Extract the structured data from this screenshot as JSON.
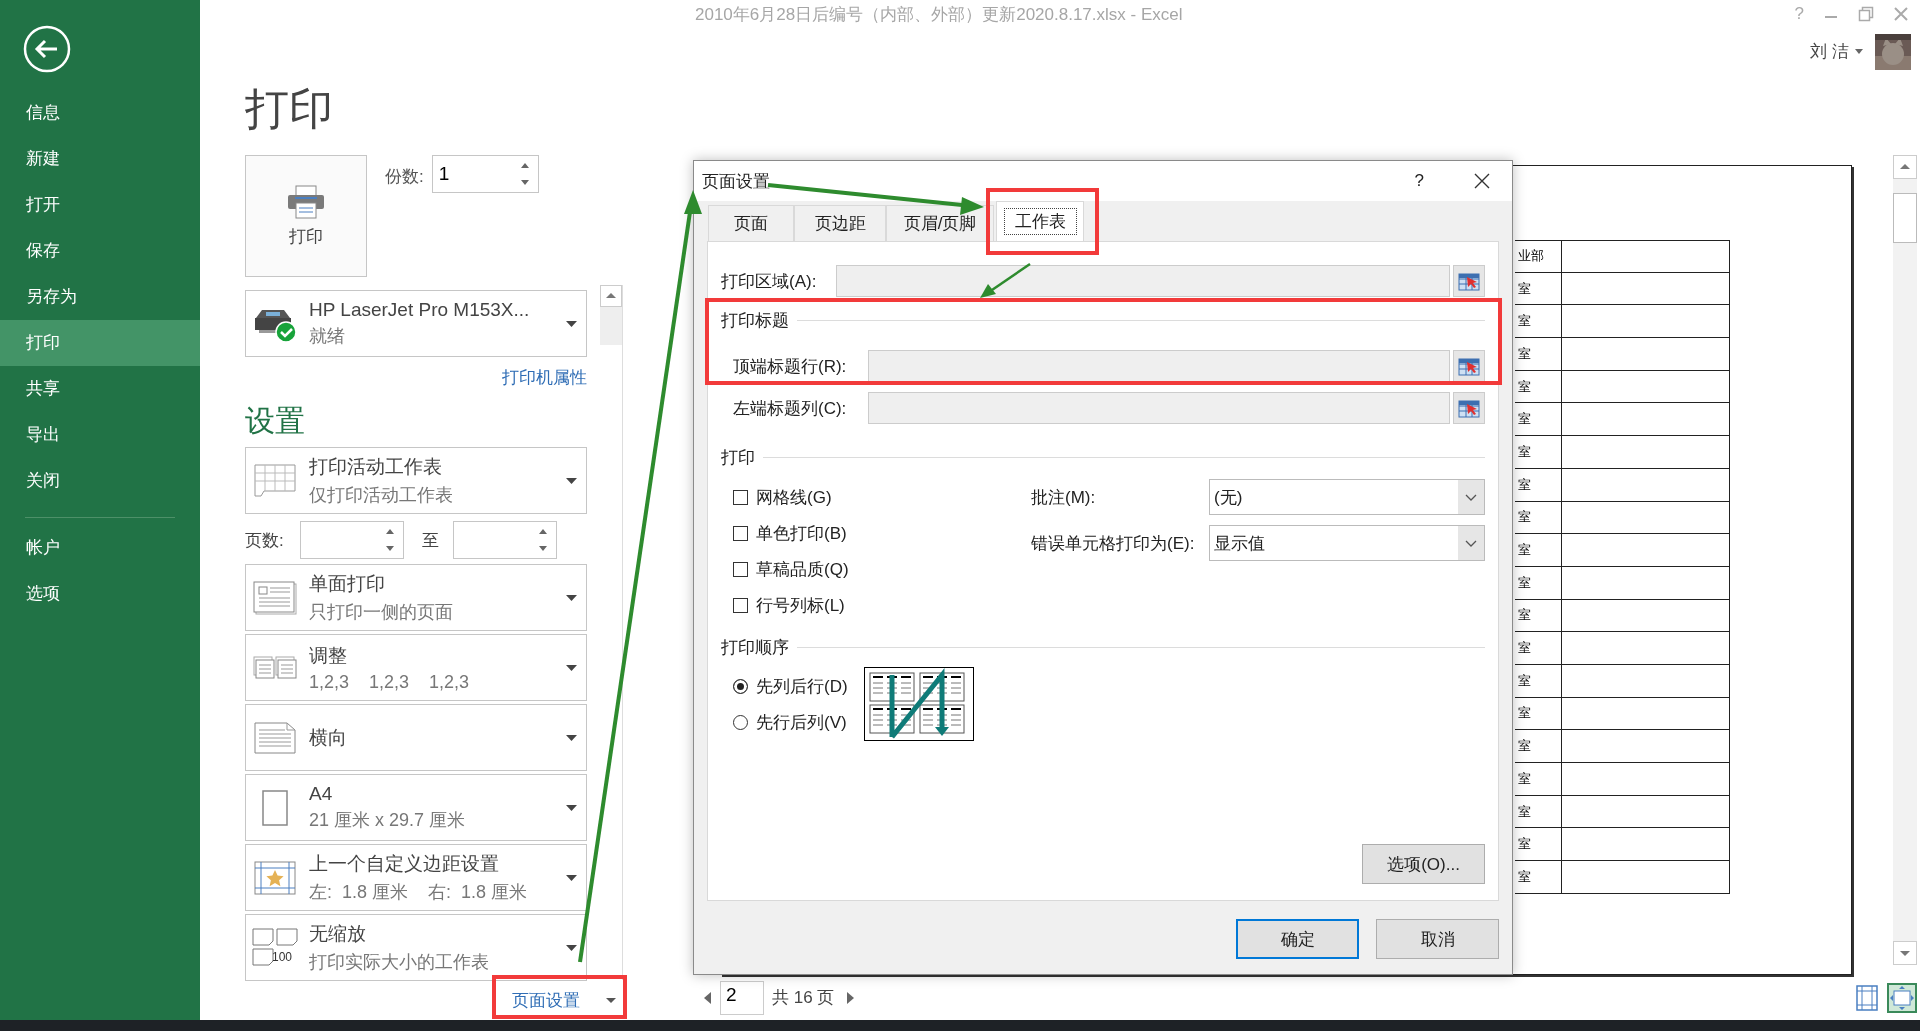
{
  "window": {
    "title": "2010年6月28日后编号（内部、外部）更新2020.8.17.xlsx - Excel",
    "help": "?",
    "user": "刘 洁"
  },
  "sidebar": {
    "items": [
      {
        "label": "信息",
        "selected": false
      },
      {
        "label": "新建",
        "selected": false
      },
      {
        "label": "打开",
        "selected": false
      },
      {
        "label": "保存",
        "selected": false
      },
      {
        "label": "另存为",
        "selected": false
      },
      {
        "label": "打印",
        "selected": true
      },
      {
        "label": "共享",
        "selected": false
      },
      {
        "label": "导出",
        "selected": false
      },
      {
        "label": "关闭",
        "selected": false
      }
    ],
    "bottom_items": [
      {
        "label": "帐户",
        "selected": false
      },
      {
        "label": "选项",
        "selected": false
      }
    ]
  },
  "backstage": {
    "title": "打印",
    "print_button": "打印",
    "copies": {
      "label": "份数:",
      "value": "1"
    },
    "printer": {
      "name": "HP LaserJet Pro M153X...",
      "status": "就绪"
    },
    "printer_properties": "打印机属性",
    "settings_title": "设置",
    "settings": [
      {
        "kind": "dropdown",
        "title": "打印活动工作表",
        "subtitle": "仅打印活动工作表"
      },
      {
        "kind": "pages",
        "label": "页数:",
        "to": "至"
      },
      {
        "kind": "dropdown",
        "title": "单面打印",
        "subtitle": "只打印一侧的页面"
      },
      {
        "kind": "dropdown",
        "title": "调整",
        "subtitle": "1,2,3    1,2,3    1,2,3"
      },
      {
        "kind": "dropdown",
        "title": "横向"
      },
      {
        "kind": "dropdown",
        "title": "A4",
        "subtitle": "21 厘米 x 29.7 厘米"
      },
      {
        "kind": "dropdown",
        "title": "上一个自定义边距设置",
        "subtitle": "左:  1.8 厘米    右:  1.8 厘米"
      },
      {
        "kind": "dropdown",
        "title": "无缩放",
        "subtitle": "打印实际大小的工作表",
        "icon_label": "100"
      }
    ],
    "page_setup_link": "页面设置"
  },
  "preview": {
    "header": "业部",
    "rows": [
      "室",
      "室",
      "室",
      "室",
      "室",
      "室",
      "室",
      "室",
      "室",
      "室",
      "室",
      "室",
      "室",
      "室",
      "室",
      "室",
      "室",
      "室",
      "室"
    ],
    "page": "2",
    "total": "共 16 页"
  },
  "dialog": {
    "title": "页面设置",
    "help": "?",
    "tabs": [
      {
        "label": "页面",
        "selected": false
      },
      {
        "label": "页边距",
        "selected": false
      },
      {
        "label": "页眉/页脚",
        "selected": false
      },
      {
        "label": "工作表",
        "selected": true
      }
    ],
    "print_area_label": "打印区域(A):",
    "titles_group": "打印标题",
    "title_rows": [
      {
        "label": "顶端标题行(R):"
      },
      {
        "label": "左端标题列(C):"
      }
    ],
    "print_group": "打印",
    "checkboxes": [
      {
        "label": "网格线(G)",
        "checked": false
      },
      {
        "label": "单色打印(B)",
        "checked": false
      },
      {
        "label": "草稿品质(Q)",
        "checked": false
      },
      {
        "label": "行号列标(L)",
        "checked": false
      }
    ],
    "selects": [
      {
        "label": "批注(M):",
        "value": "(无)"
      },
      {
        "label": "错误单元格打印为(E):",
        "value": "显示值"
      }
    ],
    "order_group": "打印顺序",
    "radios": [
      {
        "label": "先列后行(D)",
        "selected": true
      },
      {
        "label": "先行后列(V)",
        "selected": false
      }
    ],
    "options_button": "选项(O)...",
    "ok_button": "确定",
    "cancel_button": "取消"
  }
}
